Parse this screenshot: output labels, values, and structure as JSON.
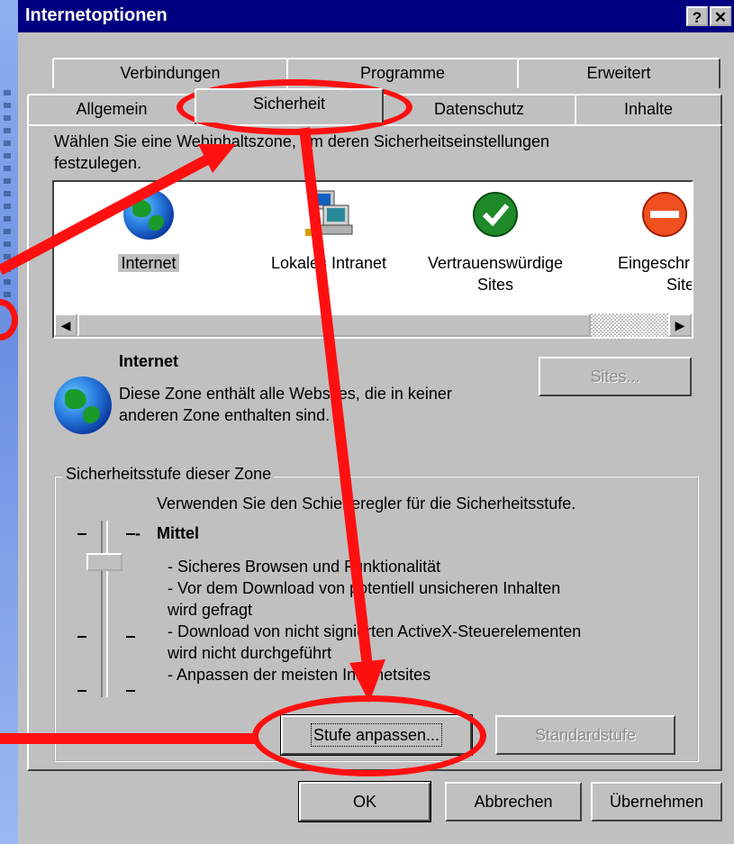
{
  "window": {
    "title": "Internetoptionen",
    "help_label": "?",
    "close_label": "✕"
  },
  "tabs_row1": [
    "Verbindungen",
    "Programme",
    "Erweitert"
  ],
  "tabs_row2": [
    "Allgemein",
    "Sicherheit",
    "Datenschutz",
    "Inhalte"
  ],
  "active_tab": "Sicherheit",
  "instruction_line1": "Wählen Sie eine Webinhaltszone, um deren Sicherheitseinstellungen",
  "instruction_line2": "festzulegen.",
  "zones": [
    {
      "label": "Internet",
      "icon": "globe-icon",
      "selected": true
    },
    {
      "label": "Lokales Intranet",
      "icon": "intranet-computer-icon"
    },
    {
      "label": "Vertrauenswürdige Sites",
      "line1": "Vertrauenswürdige",
      "line2": "Sites",
      "icon": "checkmark-icon"
    },
    {
      "label": "Eingeschränkte Sites",
      "line1": "Eingeschr",
      "line2": "Site",
      "icon": "restricted-icon"
    }
  ],
  "zone_info": {
    "name": "Internet",
    "desc_line1": "Diese Zone enthält alle Websites, die in keiner",
    "desc_line2": "anderen Zone enthalten sind.",
    "sites_button": "Sites..."
  },
  "security_level": {
    "group_label": "Sicherheitsstufe dieser Zone",
    "slider_hint": "Verwenden Sie den Schieberegler für die Sicherheitsstufe.",
    "level_dash": "-",
    "level_name": "Mittel",
    "bullets": [
      "- Sicheres Browsen und Funktionalität",
      "- Vor dem Download von potentiell unsicheren Inhalten",
      "wird gefragt",
      "- Download von nicht signierten ActiveX-Steuerelementen",
      "wird nicht durchgeführt",
      "- Anpassen der meisten Internetsites"
    ],
    "custom_button": "Stufe anpassen...",
    "default_button": "Standardstufe",
    "slider_level": 2,
    "slider_levels": 4
  },
  "footer": {
    "ok": "OK",
    "cancel": "Abbrechen",
    "apply": "Übernehmen"
  },
  "colors": {
    "titlebar": "#000080",
    "face": "#c0c0c0",
    "annotation": "#ff1010"
  }
}
